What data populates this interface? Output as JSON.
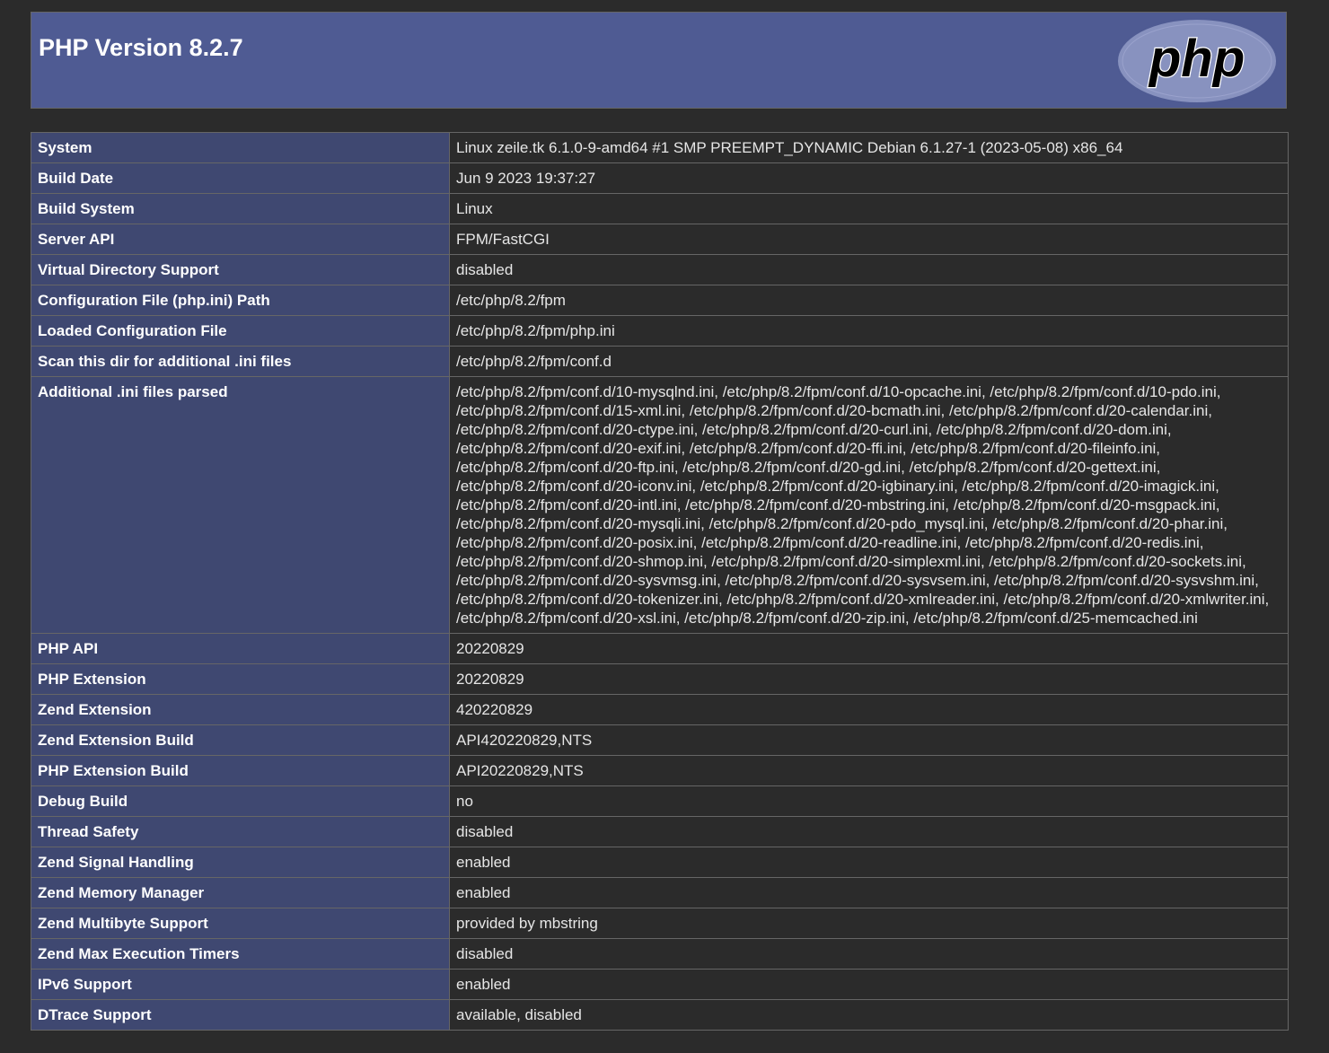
{
  "header": {
    "title": "PHP Version 8.2.7",
    "logo_text": "php"
  },
  "colors": {
    "page_bg": "#2b2b2b",
    "header_bg": "#4f5b93",
    "key_cell_bg": "#3f4871",
    "logo_ellipse": "#8892bf"
  },
  "rows": [
    {
      "key": "System",
      "value": "Linux zeile.tk 6.1.0-9-amd64 #1 SMP PREEMPT_DYNAMIC Debian 6.1.27-1 (2023-05-08) x86_64"
    },
    {
      "key": "Build Date",
      "value": "Jun 9 2023 19:37:27"
    },
    {
      "key": "Build System",
      "value": "Linux"
    },
    {
      "key": "Server API",
      "value": "FPM/FastCGI"
    },
    {
      "key": "Virtual Directory Support",
      "value": "disabled"
    },
    {
      "key": "Configuration File (php.ini) Path",
      "value": "/etc/php/8.2/fpm"
    },
    {
      "key": "Loaded Configuration File",
      "value": "/etc/php/8.2/fpm/php.ini"
    },
    {
      "key": "Scan this dir for additional .ini files",
      "value": "/etc/php/8.2/fpm/conf.d"
    },
    {
      "key": "Additional .ini files parsed",
      "value": "/etc/php/8.2/fpm/conf.d/10-mysqlnd.ini, /etc/php/8.2/fpm/conf.d/10-opcache.ini, /etc/php/8.2/fpm/conf.d/10-pdo.ini, /etc/php/8.2/fpm/conf.d/15-xml.ini, /etc/php/8.2/fpm/conf.d/20-bcmath.ini, /etc/php/8.2/fpm/conf.d/20-calendar.ini, /etc/php/8.2/fpm/conf.d/20-ctype.ini, /etc/php/8.2/fpm/conf.d/20-curl.ini, /etc/php/8.2/fpm/conf.d/20-dom.ini, /etc/php/8.2/fpm/conf.d/20-exif.ini, /etc/php/8.2/fpm/conf.d/20-ffi.ini, /etc/php/8.2/fpm/conf.d/20-fileinfo.ini, /etc/php/8.2/fpm/conf.d/20-ftp.ini, /etc/php/8.2/fpm/conf.d/20-gd.ini, /etc/php/8.2/fpm/conf.d/20-gettext.ini, /etc/php/8.2/fpm/conf.d/20-iconv.ini, /etc/php/8.2/fpm/conf.d/20-igbinary.ini, /etc/php/8.2/fpm/conf.d/20-imagick.ini, /etc/php/8.2/fpm/conf.d/20-intl.ini, /etc/php/8.2/fpm/conf.d/20-mbstring.ini, /etc/php/8.2/fpm/conf.d/20-msgpack.ini, /etc/php/8.2/fpm/conf.d/20-mysqli.ini, /etc/php/8.2/fpm/conf.d/20-pdo_mysql.ini, /etc/php/8.2/fpm/conf.d/20-phar.ini, /etc/php/8.2/fpm/conf.d/20-posix.ini, /etc/php/8.2/fpm/conf.d/20-readline.ini, /etc/php/8.2/fpm/conf.d/20-redis.ini, /etc/php/8.2/fpm/conf.d/20-shmop.ini, /etc/php/8.2/fpm/conf.d/20-simplexml.ini, /etc/php/8.2/fpm/conf.d/20-sockets.ini, /etc/php/8.2/fpm/conf.d/20-sysvmsg.ini, /etc/php/8.2/fpm/conf.d/20-sysvsem.ini, /etc/php/8.2/fpm/conf.d/20-sysvshm.ini, /etc/php/8.2/fpm/conf.d/20-tokenizer.ini, /etc/php/8.2/fpm/conf.d/20-xmlreader.ini, /etc/php/8.2/fpm/conf.d/20-xmlwriter.ini, /etc/php/8.2/fpm/conf.d/20-xsl.ini, /etc/php/8.2/fpm/conf.d/20-zip.ini, /etc/php/8.2/fpm/conf.d/25-memcached.ini"
    },
    {
      "key": "PHP API",
      "value": "20220829"
    },
    {
      "key": "PHP Extension",
      "value": "20220829"
    },
    {
      "key": "Zend Extension",
      "value": "420220829"
    },
    {
      "key": "Zend Extension Build",
      "value": "API420220829,NTS"
    },
    {
      "key": "PHP Extension Build",
      "value": "API20220829,NTS"
    },
    {
      "key": "Debug Build",
      "value": "no"
    },
    {
      "key": "Thread Safety",
      "value": "disabled"
    },
    {
      "key": "Zend Signal Handling",
      "value": "enabled"
    },
    {
      "key": "Zend Memory Manager",
      "value": "enabled"
    },
    {
      "key": "Zend Multibyte Support",
      "value": "provided by mbstring"
    },
    {
      "key": "Zend Max Execution Timers",
      "value": "disabled"
    },
    {
      "key": "IPv6 Support",
      "value": "enabled"
    },
    {
      "key": "DTrace Support",
      "value": "available, disabled"
    }
  ]
}
